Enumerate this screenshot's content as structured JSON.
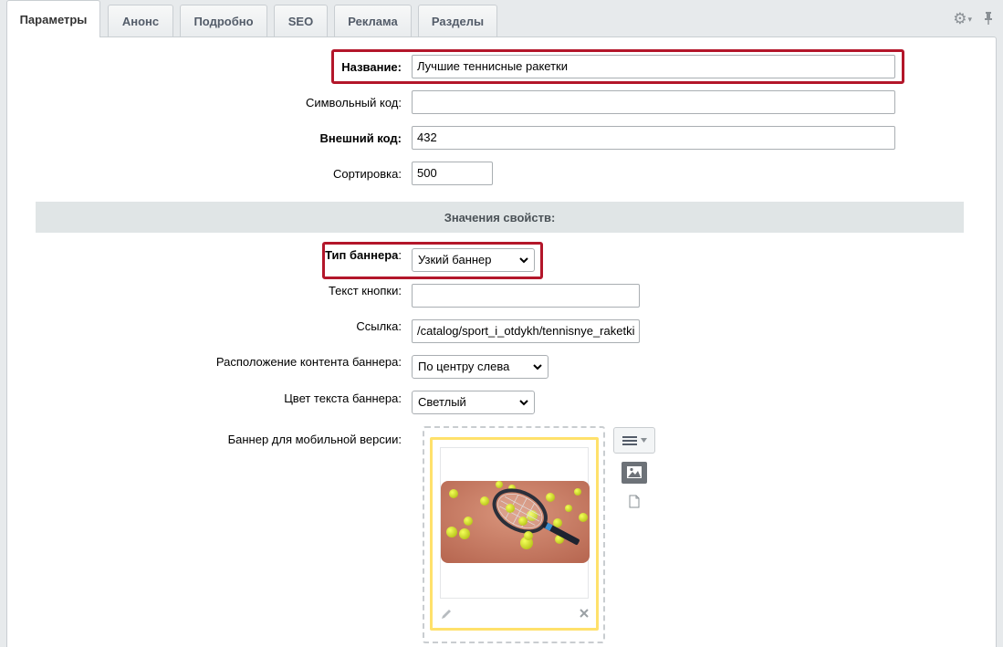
{
  "tabs": [
    {
      "label": "Параметры",
      "active": true
    },
    {
      "label": "Анонс"
    },
    {
      "label": "Подробно"
    },
    {
      "label": "SEO"
    },
    {
      "label": "Реклама"
    },
    {
      "label": "Разделы"
    }
  ],
  "toolbar": {
    "settings_icon": "gear-icon",
    "pin_icon": "pin-icon"
  },
  "form": {
    "name": {
      "label": "Название:",
      "value": "Лучшие теннисные ракетки"
    },
    "code": {
      "label": "Символьный код:",
      "value": ""
    },
    "external_code": {
      "label": "Внешний код:",
      "value": "432"
    },
    "sort": {
      "label": "Сортировка:",
      "value": "500"
    }
  },
  "properties": {
    "section_title": "Значения свойств:",
    "banner_type": {
      "label": "Тип баннера",
      "colon": ":",
      "value": "Узкий баннер"
    },
    "button_text": {
      "label": "Текст кнопки:",
      "value": ""
    },
    "link": {
      "label": "Ссылка:",
      "value": "/catalog/sport_i_otdykh/tennisnye_raketki"
    },
    "content_position": {
      "label": "Расположение контента баннера:",
      "value": "По центру слева"
    },
    "text_color": {
      "label": "Цвет текста баннера:",
      "value": "Светлый"
    },
    "mobile_banner": {
      "label": "Баннер для мобильной версии:"
    }
  },
  "colors": {
    "highlight": "#b3162a",
    "image_card_border": "#ffe16b",
    "section_bg": "#e0e5e6"
  }
}
